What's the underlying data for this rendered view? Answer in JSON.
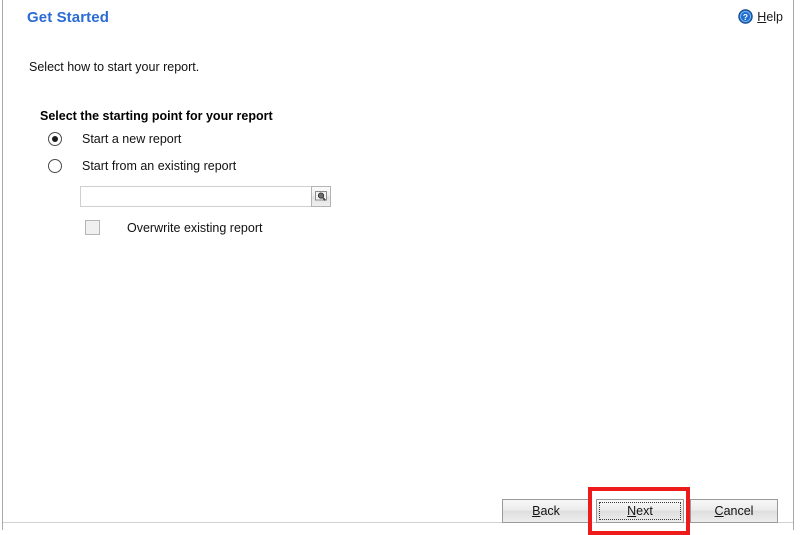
{
  "window": {
    "title": "Get Started",
    "accent_color": "#2a6bd4",
    "highlight_color": "#ee1b1b"
  },
  "header": {
    "title": "Get Started",
    "help_label_pre": "H",
    "help_label_post": "elp",
    "help_icon": "help-circle-icon"
  },
  "body": {
    "subtitle": "Select how to start your report.",
    "group_heading": "Select the starting point for your report",
    "options": [
      {
        "label": "Start a new report",
        "selected": true
      },
      {
        "label": "Start from an existing report",
        "selected": false
      }
    ],
    "file_field": {
      "value": "",
      "placeholder": "",
      "browse_icon": "browse-magnifier-icon"
    },
    "checkbox": {
      "label": "Overwrite existing report",
      "checked": false
    }
  },
  "footer": {
    "buttons": [
      {
        "name": "back",
        "mnemonic": "B",
        "rest": "ack",
        "focused": false
      },
      {
        "name": "next",
        "mnemonic": "N",
        "rest": "ext",
        "focused": true
      },
      {
        "name": "cancel",
        "mnemonic": "C",
        "rest": "ancel",
        "focused": false
      }
    ]
  }
}
